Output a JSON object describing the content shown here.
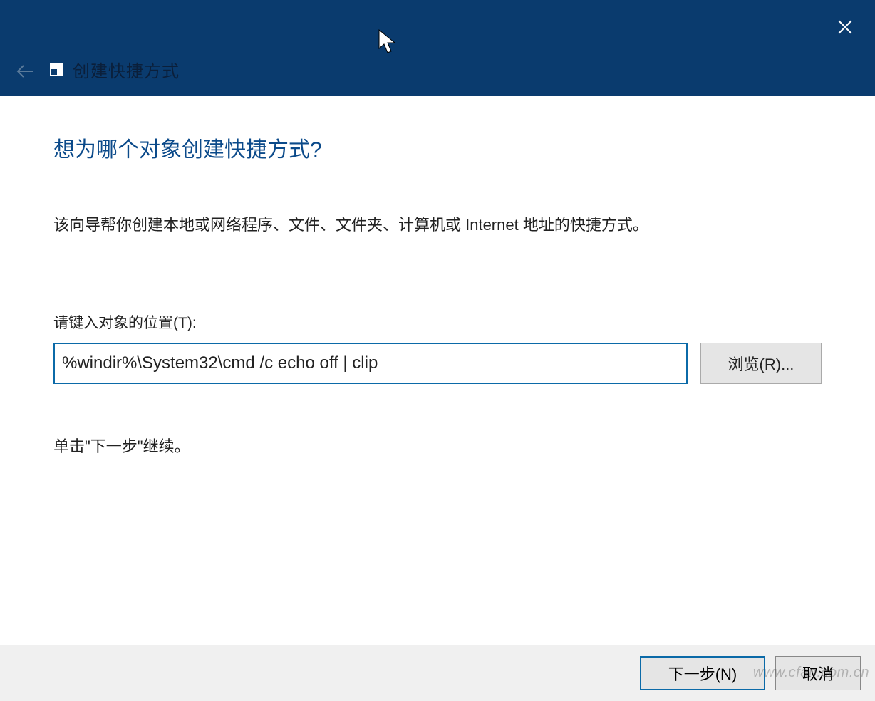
{
  "titlebar": {
    "window_title": "创建快捷方式"
  },
  "wizard": {
    "heading": "想为哪个对象创建快捷方式?",
    "description": "该向导帮你创建本地或网络程序、文件、文件夹、计算机或 Internet 地址的快捷方式。",
    "field_label": "请键入对象的位置(T):",
    "location_value": "%windir%\\System32\\cmd /c echo off | clip",
    "browse_label": "浏览(R)...",
    "continue_hint": "单击\"下一步\"继续。"
  },
  "footer": {
    "next_label": "下一步(N)",
    "cancel_label": "取消"
  },
  "watermark": "www.cfan.com.cn"
}
